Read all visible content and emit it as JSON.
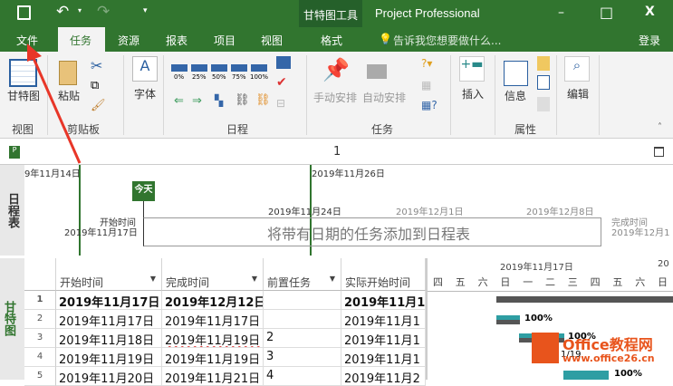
{
  "title_bar": {
    "context_tool": "甘特图工具",
    "app_title": "Project Professional",
    "minimize": "–",
    "maximize": "□",
    "close": "X"
  },
  "tabs": [
    {
      "label": "文件"
    },
    {
      "label": "任务",
      "active": true
    },
    {
      "label": "资源"
    },
    {
      "label": "报表"
    },
    {
      "label": "项目"
    },
    {
      "label": "视图"
    },
    {
      "label": "格式"
    }
  ],
  "tell_me": "告诉我您想要做什么...",
  "sign_in": "登录",
  "ribbon": {
    "view_group": {
      "gantt": "甘特图",
      "label": "视图"
    },
    "clipboard": {
      "paste": "粘贴",
      "label": "剪贴板"
    },
    "font": {
      "font": "字体"
    },
    "schedule": {
      "percents": [
        "0%",
        "25%",
        "50%",
        "75%",
        "100%"
      ],
      "label": "日程"
    },
    "tasks": {
      "manual": "手动安排",
      "auto": "自动安排",
      "label": "任务"
    },
    "insert": {
      "insert": "插入"
    },
    "properties": {
      "info": "信息",
      "label": "属性"
    },
    "editing": {
      "edit": "编辑"
    }
  },
  "view_bar": {
    "page": "1"
  },
  "timeline": {
    "side_label": "日程表",
    "top_dates": [
      "9年11月14日",
      "2019年11月26日"
    ],
    "today": "今天",
    "scale_dates": [
      "2019年11月24日",
      "2019年12月1日",
      "2019年12月8日"
    ],
    "start_label": "开始时间",
    "start_date": "2019年11月17日",
    "finish_label": "完成时间",
    "finish_date": "2019年12月1",
    "placeholder": "将带有日期的任务添加到日程表"
  },
  "table": {
    "side_label": "甘特图",
    "columns": [
      "开始时间",
      "完成时间",
      "前置任务",
      "实际开始时间"
    ],
    "rows": [
      {
        "id": "1",
        "start": "2019年11月17日",
        "finish": "2019年12月12日",
        "pred": "",
        "actual": "2019年11月1",
        "bold": true
      },
      {
        "id": "2",
        "start": "2019年11月17日",
        "finish": "2019年11月17日",
        "pred": "",
        "actual": "2019年11月1"
      },
      {
        "id": "3",
        "start": "2019年11月18日",
        "finish": "2019年11月19日",
        "pred": "2",
        "actual": "2019年11月1"
      },
      {
        "id": "4",
        "start": "2019年11月19日",
        "finish": "2019年11月19日",
        "pred": "3",
        "actual": "2019年11月1"
      },
      {
        "id": "5",
        "start": "2019年11月20日",
        "finish": "2019年11月21日",
        "pred": "4",
        "actual": "2019年11月2"
      }
    ]
  },
  "gantt": {
    "week_label": "2019年11月17日",
    "next_week_label": "20",
    "days": [
      "四",
      "五",
      "六",
      "日",
      "一",
      "二",
      "三",
      "四",
      "五",
      "六",
      "日"
    ],
    "labels": [
      "100%",
      "100%",
      "1/19",
      "100%"
    ]
  },
  "watermark": {
    "brand": "Office教程网",
    "url": "www.office26.cn"
  },
  "colors": {
    "accent": "#31752f",
    "bar": "#2e9ea3",
    "summary": "#555555"
  }
}
